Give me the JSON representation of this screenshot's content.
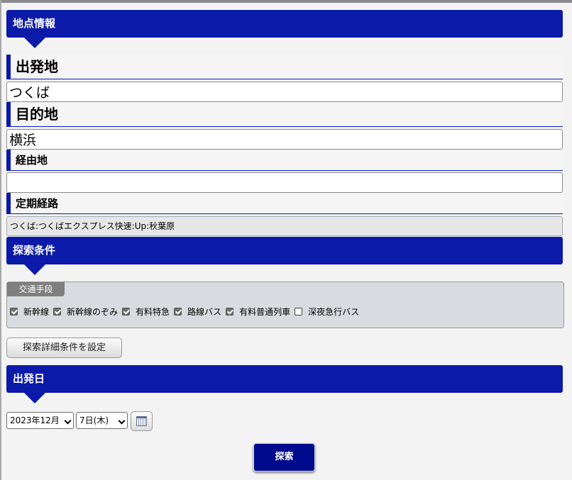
{
  "location_section": {
    "title": "地点情報"
  },
  "origin": {
    "label": "出発地",
    "value": "つくば"
  },
  "destination": {
    "label": "目的地",
    "value": "横浜"
  },
  "via": {
    "label": "経由地",
    "value": ""
  },
  "commuter_route": {
    "label": "定期経路",
    "value": "つくば:つくばエクスプレス快速:Up:秋葉原"
  },
  "conditions_section": {
    "title": "探索条件"
  },
  "transport": {
    "tab_label": "交通手段",
    "options": [
      {
        "label": "新幹線",
        "checked": true
      },
      {
        "label": "新幹線のぞみ",
        "checked": true
      },
      {
        "label": "有料特急",
        "checked": true
      },
      {
        "label": "路線バス",
        "checked": true
      },
      {
        "label": "有料普通列車",
        "checked": true
      },
      {
        "label": "深夜急行バス",
        "checked": false
      }
    ]
  },
  "detail_button": {
    "label": "探索詳細条件を設定"
  },
  "date_section": {
    "title": "出発日"
  },
  "date": {
    "month_value": "2023年12月",
    "day_value": "7日(木)",
    "calendar_icon": "calendar-icon"
  },
  "search_button": {
    "label": "探索"
  },
  "colors": {
    "header_blue": "#0b1aa8",
    "search_button": "#000a8c"
  }
}
